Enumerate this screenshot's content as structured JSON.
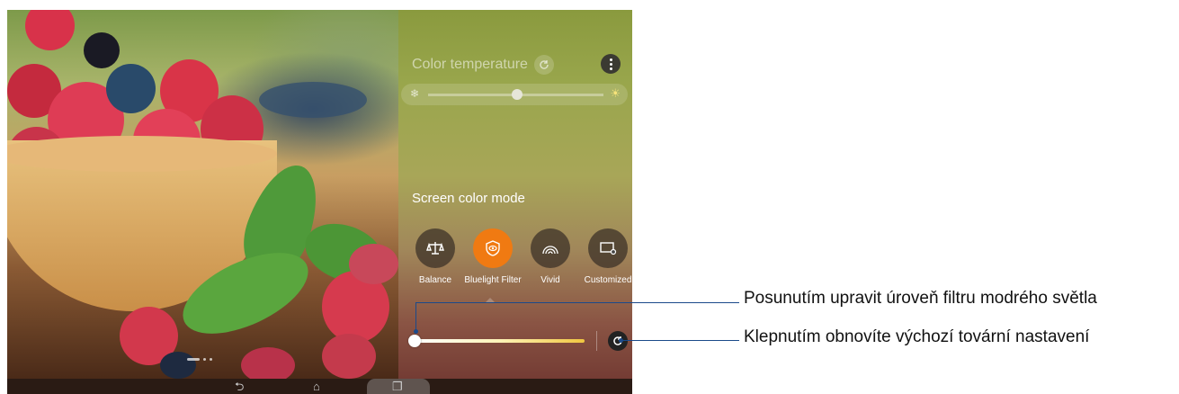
{
  "panel": {
    "color_temperature_title": "Color temperature",
    "screen_color_mode_title": "Screen color mode",
    "modes": [
      {
        "label": "Balance",
        "icon": "balance-scale-icon"
      },
      {
        "label": "Bluelight Filter",
        "icon": "eye-shield-icon"
      },
      {
        "label": "Vivid",
        "icon": "vivid-rainbow-icon"
      },
      {
        "label": "Customized",
        "icon": "customize-screen-icon"
      }
    ],
    "active_mode": "Bluelight Filter",
    "color_temperature_level": 0.5,
    "bluelight_filter_level": 0
  },
  "navbar": {
    "back_icon": "back-icon",
    "home_icon": "home-icon",
    "recents_icon": "recent-apps-icon"
  },
  "callouts": {
    "slider": "Posunutím upravit úroveň filtru modrého světla",
    "reset": "Klepnutím obnovíte výchozí tovární nastavení"
  },
  "colors": {
    "accent": "#f07a12",
    "callout_line": "#1b4a8a"
  }
}
